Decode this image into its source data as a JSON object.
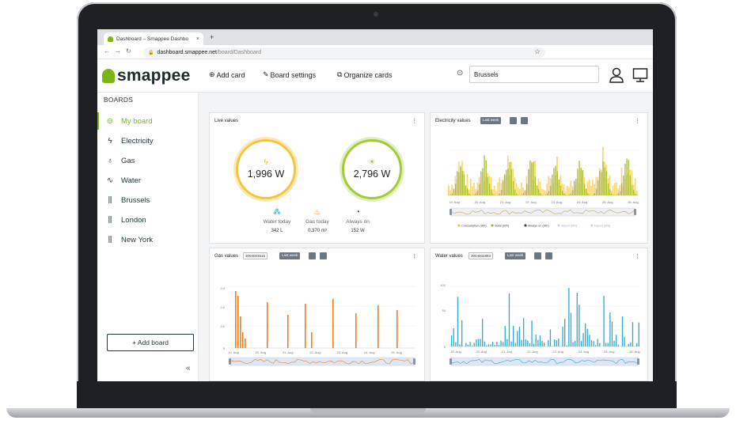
{
  "browser": {
    "tab_title": "Dashboard – Smappee Dashbo",
    "new_tab": "+",
    "url_host": "dashboard.smappee.net",
    "url_path": "/board/Dashboard"
  },
  "header": {
    "logo": "smappee",
    "add_card": "Add card",
    "board_settings": "Board settings",
    "organize_cards": "Organize cards",
    "location": "Brussels"
  },
  "sidebar": {
    "title": "BOARDS",
    "items": [
      {
        "label": "My board",
        "icon": "board-icon"
      },
      {
        "label": "Electricity",
        "icon": "lightning-icon"
      },
      {
        "label": "Gas",
        "icon": "flame-icon"
      },
      {
        "label": "Water",
        "icon": "water-icon"
      },
      {
        "label": "Brussels",
        "icon": "bar-chart-icon"
      },
      {
        "label": "London",
        "icon": "bar-chart-icon"
      },
      {
        "label": "New York",
        "icon": "bar-chart-icon"
      }
    ],
    "add_board": "+ Add board"
  },
  "cards": {
    "live": {
      "title": "Live values",
      "consumption": "1,996 W",
      "solar": "2,796 W",
      "stats": [
        {
          "label": "Water today",
          "value": "342 L"
        },
        {
          "label": "Gas today",
          "value": "0.370 m³"
        },
        {
          "label": "Always on",
          "value": "152 W"
        }
      ]
    },
    "electricity": {
      "title": "Electricity values",
      "range": "Last week",
      "xticks": [
        "19. Aug",
        "20. Aug",
        "21. Aug",
        "22. Aug",
        "23. Aug",
        "24. Aug",
        "25. Aug",
        "26. Aug"
      ],
      "legend": [
        "Consumption (Wh)",
        "Solar (Wh)",
        "Always on (Wh)",
        "Import (Wh)",
        "Export (Wh)"
      ]
    },
    "gas": {
      "title": "Gas values",
      "meter": "3004003516",
      "range": "Last week",
      "xticks": [
        "19. Aug",
        "20. Aug",
        "21. Aug",
        "22. Aug",
        "23. Aug",
        "24. Aug",
        "25. Aug"
      ]
    },
    "water": {
      "title": "Water values",
      "meter": "3004002883",
      "range": "Last week",
      "xticks": [
        "19. Aug",
        "20. Aug",
        "21. Aug",
        "22. Aug",
        "23. Aug",
        "24. Aug",
        "25. Aug",
        "26. Aug"
      ]
    }
  },
  "colors": {
    "brand": "#7cb518",
    "consumption": "#f5c542",
    "solar": "#a5b92a",
    "gas": "#f07f1a",
    "water": "#2aa9d2"
  }
}
